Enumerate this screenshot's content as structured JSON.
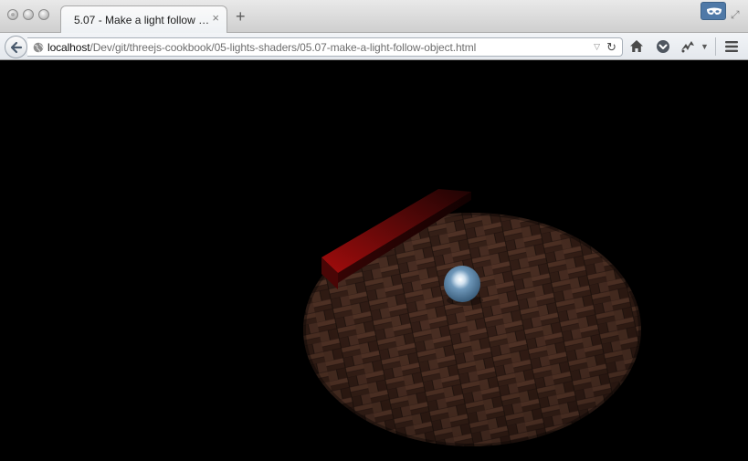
{
  "window": {
    "buttons": [
      "close",
      "minimize",
      "zoom"
    ]
  },
  "tab": {
    "title": "5.07 - Make a light follow an ...",
    "close_glyph": "×",
    "new_tab_glyph": "+"
  },
  "toolbar": {
    "url_host": "localhost",
    "url_path": "/Dev/git/threejs-cookbook/05-lights-shaders/05.07-make-a-light-follow-object.html",
    "icons": [
      "back-arrow-icon",
      "globe-icon",
      "url-dropdown-icon",
      "reload-icon",
      "home-icon",
      "pocket-icon",
      "extension-icon",
      "menu-icon",
      "private-mask-icon",
      "fullscreen-icon"
    ]
  },
  "scene": {
    "background": "#000000",
    "floor_color": "#3a2219",
    "box_color": "#8a0a0a",
    "sphere_color": "#5d86a8"
  }
}
